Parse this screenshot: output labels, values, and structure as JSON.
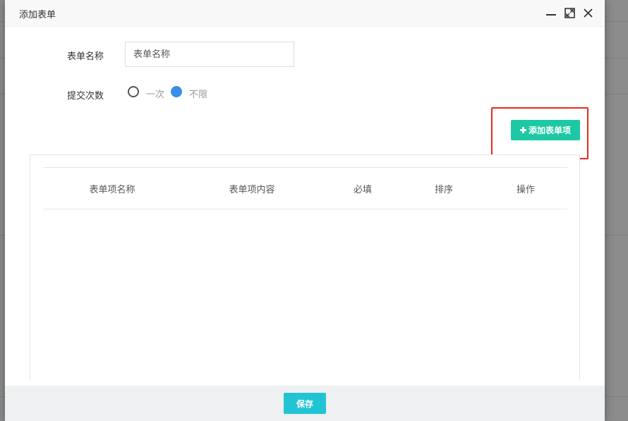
{
  "dialog": {
    "title": "添加表单",
    "controls": [
      "minimize-icon",
      "maximize-icon",
      "close-icon"
    ]
  },
  "form": {
    "name_label": "表单名称",
    "name_input_placeholder": "表单名称",
    "name_input_value": "",
    "submit_count_label": "提交次数",
    "submit_count_options": [
      {
        "label": "一次",
        "selected": false
      },
      {
        "label": "不限",
        "selected": true
      }
    ]
  },
  "toolbar": {
    "add_item_label": "添加表单项",
    "add_item_icon": "plus-icon"
  },
  "table": {
    "columns": [
      "表单项名称",
      "表单项内容",
      "必填",
      "排序",
      "操作"
    ],
    "rows": []
  },
  "footer": {
    "save_label": "保存"
  },
  "colors": {
    "add_button": "#1ec8a5",
    "save_button": "#22c4d3",
    "radio_selected": "#3a8ee6",
    "highlight_border": "#e8291e"
  }
}
